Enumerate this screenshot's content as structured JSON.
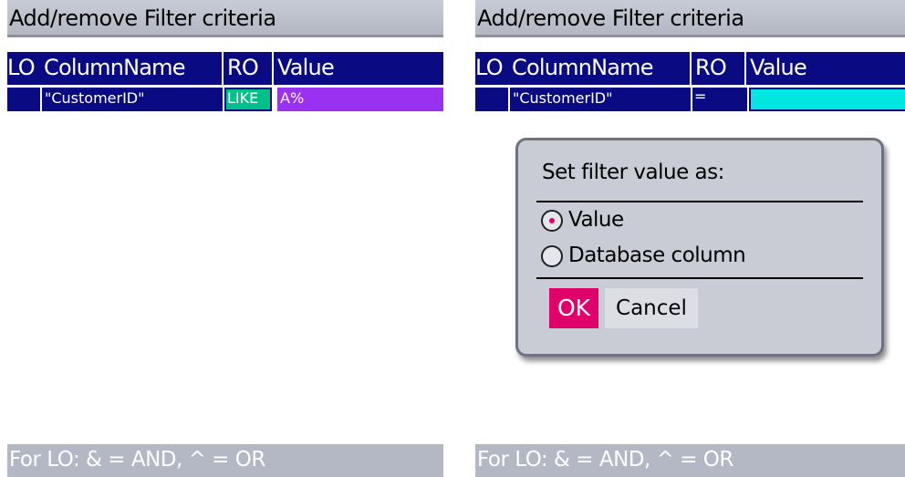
{
  "left": {
    "title": "Add/remove Filter criteria",
    "columns": [
      "LO",
      "ColumnName",
      "RO",
      "Value"
    ],
    "row": {
      "lo": "",
      "column_name": "\"CustomerID\"",
      "ro": "LIKE",
      "value": "A%"
    },
    "status": "For LO: & = AND, ^ = OR"
  },
  "right": {
    "title": "Add/remove Filter criteria",
    "columns": [
      "LO",
      "ColumnName",
      "RO",
      "Value"
    ],
    "row": {
      "lo": "",
      "column_name": "\"CustomerID\"",
      "ro": "=",
      "value": ""
    },
    "status": "For LO: & = AND, ^ = OR",
    "dialog": {
      "title": "Set filter value as:",
      "options": [
        {
          "label": "Value",
          "checked": true
        },
        {
          "label": "Database column",
          "checked": false
        }
      ],
      "ok_label": "OK",
      "cancel_label": "Cancel"
    }
  },
  "colors": {
    "header_bg": "#0a0a82",
    "ro_bg_left": "#00c08a",
    "value_bg_left": "#9a30f0",
    "value_bg_right": "#00e6e0",
    "accent": "#e0006a",
    "status_bg": "#b4b8c4"
  }
}
